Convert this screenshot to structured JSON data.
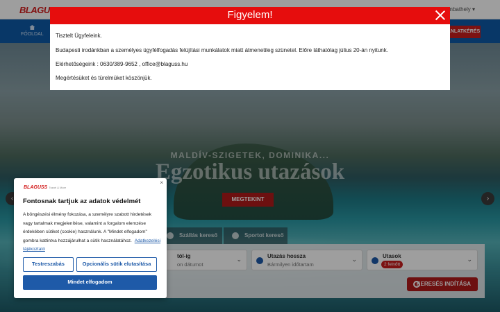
{
  "header": {
    "logo": "BLAGUSS",
    "city": "Szombathely ▾"
  },
  "nav": {
    "home_label": "FŐOLDAL",
    "offer_label": "AJÁNLATKÉRÉS"
  },
  "hero": {
    "subtitle": "MALDÍV-SZIGETEK, DOMINIKA...",
    "title": "Egzotikus utazások",
    "button": "MEGTEKINT",
    "prev": "‹",
    "next": "›"
  },
  "search": {
    "tabs": [
      "Szállás kereső",
      "Sportot kereső"
    ],
    "date": {
      "label": "tól-ig",
      "value": "on dátumot"
    },
    "duration": {
      "label": "Utazás hossza",
      "value": "Bármilyen időtartam"
    },
    "travelers": {
      "label": "Utasok",
      "badge": "2 felnőtt"
    },
    "button": "KERESÉS INDÍTÁSA"
  },
  "modal": {
    "title": "Figyelem!",
    "greeting": "Tisztelt Ügyfeleink.",
    "notice": "Budapesti irodánkban a személyes ügyfélfogadás felújítási munkálatok miatt átmenetileg szünetel. Előre láthatólag július 20-án nyitunk.",
    "contact": "Elérhetőségeink : 0630/389-9652 , office@blaguss.hu",
    "thanks": "Megértésüket és türelmüket köszönjük."
  },
  "cookie": {
    "logo": "BLAGUSS",
    "logo_tag": "Travel & More",
    "title": "Fontosnak tartjuk az adatok védelmét",
    "text": "A böngészési élmény fokozása, a személyre szabott hirdetések vagy tartalmak megjelenítése, valamint a forgalom elemzése érdekében sütiket (cookie) használunk. A \"Mindet elfogadom\" gombra kattintva hozzájárulhat a sütik használatához.",
    "link": "Adatkezelési tájékoztató",
    "customize": "Testreszabás",
    "reject": "Opcionális sütik elutasítása",
    "accept": "Mindet elfogadom",
    "close": "×"
  },
  "colors": {
    "brand_red": "#e60d0d",
    "primary_blue": "#1e5aa8",
    "nav_blue": "#0d5aa7"
  }
}
